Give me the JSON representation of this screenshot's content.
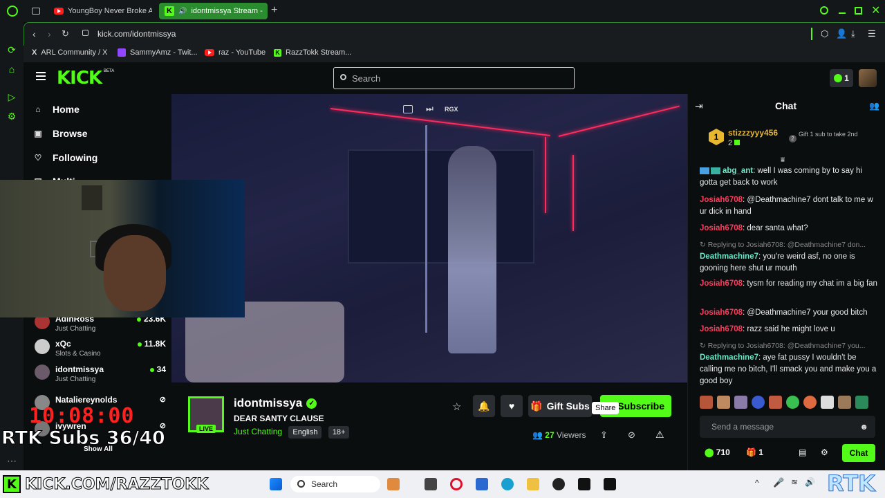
{
  "browser": {
    "tabs": [
      {
        "label": "YoungBoy Never Broke Ag",
        "icon": "youtube-icon",
        "active": false
      },
      {
        "label": "idontmissya Stream -",
        "icon": "kick-icon",
        "active": true
      }
    ],
    "new_tab": "+",
    "url": "kick.com/idontmissya",
    "bookmarks": [
      {
        "label": "ARL Community / X",
        "icon": "x-icon"
      },
      {
        "label": "SammyAmz - Twit...",
        "icon": "twitch-icon"
      },
      {
        "label": "raz - YouTube",
        "icon": "youtube-icon"
      },
      {
        "label": "RazzTokk Stream...",
        "icon": "kick-icon"
      }
    ]
  },
  "header": {
    "logo": "KICK",
    "logo_badge": "BETA",
    "search_placeholder": "Search",
    "kicks_count": "1"
  },
  "nav": {
    "items": [
      {
        "label": "Home",
        "icon": "home-icon"
      },
      {
        "label": "Browse",
        "icon": "browse-icon"
      },
      {
        "label": "Following",
        "icon": "heart-icon"
      },
      {
        "label": "Multi...",
        "icon": "multistream-icon"
      }
    ],
    "channels": [
      {
        "name": "AdinRoss",
        "category": "Just Chatting",
        "viewers": "23.6K"
      },
      {
        "name": "xQc",
        "category": "Slots & Casino",
        "viewers": "11.8K"
      },
      {
        "name": "idontmissya",
        "category": "Just Chatting",
        "viewers": "34"
      },
      {
        "name": "Nataliereynolds",
        "category": "",
        "viewers": ""
      },
      {
        "name": "ivywren",
        "category": "",
        "viewers": ""
      }
    ],
    "show_all": "Show All"
  },
  "video": {
    "controls": [
      "popout-icon",
      "skip-icon"
    ],
    "control_text": "RGX"
  },
  "stream": {
    "channel": "idontmissya",
    "title": "DEAR SANTY CLAUSE",
    "category": "Just Chatting",
    "tags": [
      "English",
      "18+"
    ],
    "live_badge": "LIVE",
    "viewers_count": "27",
    "viewers_label": "Viewers",
    "gift_label": "Gift Subs",
    "subscribe_label": "Subscribe",
    "share_tooltip": "Share"
  },
  "chat": {
    "title": "Chat",
    "pinned": {
      "rank": "1",
      "user": "stizzzyyy456",
      "count": "2",
      "gift_rank": "2",
      "gift_text": "Gift 1 sub to take 2nd"
    },
    "messages": [
      {
        "reply": "",
        "user": "abg_ant",
        "text": ": well I was coming by to say hi gotta get back to work",
        "color": "teal"
      },
      {
        "reply": "",
        "user": "Josiah6708",
        "text": ": @Deathmachine7 dont talk to me w ur dick in hand",
        "color": "red"
      },
      {
        "reply": "",
        "user": "Josiah6708",
        "text": ": dear santa what?",
        "color": "red"
      },
      {
        "reply": "Replying to Josiah6708: @Deathmachine7 don...",
        "user": "Deathmachine7",
        "text": ": you're weird asf, no one is gooning here shut ur mouth",
        "color": "teal"
      },
      {
        "reply": "",
        "user": "Josiah6708",
        "text": ": tysm for reading my chat im a big fan",
        "color": "red"
      },
      {
        "reply": "",
        "user": "Josiah6708",
        "text": ": @Deathmachine7 your good bitch",
        "color": "red"
      },
      {
        "reply": "",
        "user": "Josiah6708",
        "text": ": razz said he might love u",
        "color": "red"
      },
      {
        "reply": "Replying to Josiah6708: @Deathmachine7 you...",
        "user": "Deathmachine7",
        "text": ": aye fat pussy I wouldn't be calling me no bitch, I'll smack you and make you a good boy",
        "color": "teal"
      }
    ],
    "input_placeholder": "Send a message",
    "points": "710",
    "subs": "1",
    "send_label": "Chat"
  },
  "overlay": {
    "timer": "10:08:00",
    "subs_goal": "RTK Subs 36/40",
    "promo": "KICK.COM/RAZZTOKK",
    "promo_icon_letter": "K",
    "watermark": "RTK"
  },
  "taskbar": {
    "search": "Search"
  }
}
